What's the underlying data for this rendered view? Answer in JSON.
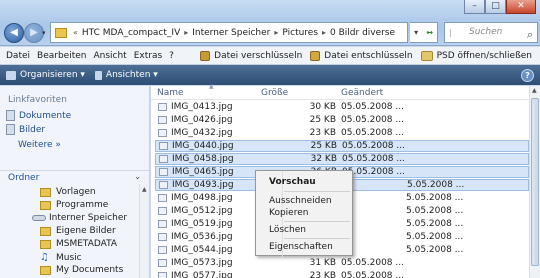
{
  "window": {
    "minimize": "–",
    "maximize": "□",
    "close": "✕"
  },
  "nav": {
    "back": "◀",
    "forward": "▶",
    "dropdown": "▾"
  },
  "address": {
    "prefix": "«",
    "segments": [
      "HTC MDA_compact_IV",
      "Interner Speicher",
      "Pictures",
      "0 Bildr diverse"
    ],
    "separator": "▸",
    "dropdown": "▾",
    "refresh": "↔"
  },
  "search": {
    "placeholder": "Suchen",
    "icon": "magnifier-icon"
  },
  "menubar": {
    "items": [
      "Datei",
      "Bearbeiten",
      "Ansicht",
      "Extras",
      "?"
    ],
    "tools": [
      "Datei verschlüsseln",
      "Datei entschlüsseln",
      "PSD öffnen/schließen"
    ]
  },
  "toolbar": {
    "organize": "Organisieren ▾",
    "views": "Ansichten ▾",
    "help": "?"
  },
  "sidebar": {
    "favorites_header": "Linkfavoriten",
    "favorites": [
      "Dokumente",
      "Bilder"
    ],
    "more": "Weitere »",
    "folders_header": "Ordner",
    "tree": [
      "Vorlagen",
      "Programme",
      "Interner Speicher",
      "Eigene Bilder",
      "MSMETADATA",
      "Music",
      "My Documents"
    ]
  },
  "columns": {
    "name": "Name",
    "size": "Größe",
    "modified": "Geändert"
  },
  "files": [
    {
      "name": "IMG_0413.jpg",
      "size": "30 KB",
      "date": "05.05.2008 ...",
      "selected": false
    },
    {
      "name": "IMG_0426.jpg",
      "size": "25 KB",
      "date": "05.05.2008 ...",
      "selected": false
    },
    {
      "name": "IMG_0432.jpg",
      "size": "23 KB",
      "date": "05.05.2008 ...",
      "selected": false
    },
    {
      "name": "IMG_0440.jpg",
      "size": "25 KB",
      "date": "05.05.2008 ...",
      "selected": true
    },
    {
      "name": "IMG_0458.jpg",
      "size": "32 KB",
      "date": "05.05.2008 ...",
      "selected": true
    },
    {
      "name": "IMG_0465.jpg",
      "size": "26 KB",
      "date": "05.05.2008 ...",
      "selected": true
    },
    {
      "name": "IMG_0493.jpg",
      "size": "",
      "date": "5.05.2008 ...",
      "selected": true
    },
    {
      "name": "IMG_0498.jpg",
      "size": "",
      "date": "5.05.2008 ...",
      "selected": false
    },
    {
      "name": "IMG_0512.jpg",
      "size": "",
      "date": "5.05.2008 ...",
      "selected": false
    },
    {
      "name": "IMG_0519.jpg",
      "size": "",
      "date": "5.05.2008 ...",
      "selected": false
    },
    {
      "name": "IMG_0536.jpg",
      "size": "",
      "date": "5.05.2008 ...",
      "selected": false
    },
    {
      "name": "IMG_0544.jpg",
      "size": "",
      "date": "5.05.2008 ...",
      "selected": false
    },
    {
      "name": "IMG_0573.jpg",
      "size": "31 KB",
      "date": "05.05.2008 ...",
      "selected": false
    },
    {
      "name": "IMG_0577.jpg",
      "size": "23 KB",
      "date": "05.05.2008 ...",
      "selected": false
    }
  ],
  "context_menu": {
    "items": [
      "Vorschau",
      "Ausschneiden",
      "Kopieren",
      "Löschen",
      "Eigenschaften"
    ]
  }
}
